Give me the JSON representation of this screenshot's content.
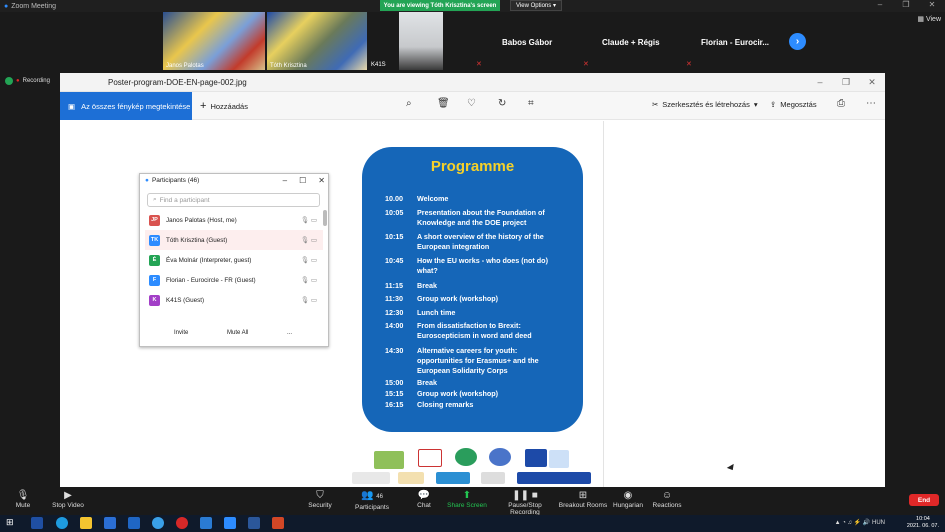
{
  "zoom": {
    "title": "Zoom Meeting",
    "viewing_banner": "You are viewing Tóth Krisztina's screen",
    "view_options": "View Options",
    "view_button": "View"
  },
  "thumbnails": [
    {
      "label": "Janos Palotas"
    },
    {
      "label": "Tóth Krisztina"
    },
    {
      "label": "K41S"
    }
  ],
  "participant_names": [
    "Babos Gábor",
    "Claude + Régis",
    "Florian - Eurocir..."
  ],
  "recording": {
    "label": "Recording"
  },
  "photos_app": {
    "filename": "Poster-program-DOE-EN-page-002.jpg",
    "all_photos": "Az összes fénykép megtekintése",
    "add": "Hozzáadás",
    "edit_create": "Szerkesztés és létrehozás",
    "share": "Megosztás"
  },
  "poster": {
    "title": "Programme",
    "rows": [
      {
        "time": "10.00",
        "event": "Welcome"
      },
      {
        "time": "10:05",
        "event": "Presentation about the Foundation of Knowledge and the DOE project"
      },
      {
        "time": "10:15",
        "event": "A short overview of the history of the European integration"
      },
      {
        "time": "10:45",
        "event": "How the EU works - who does (not do) what?"
      },
      {
        "time": "11:15",
        "event": "Break"
      },
      {
        "time": "11:30",
        "event": "Group work (workshop)"
      },
      {
        "time": "12:30",
        "event": "Lunch time"
      },
      {
        "time": "14:00",
        "event": "From dissatisfaction to Brexit: Euroscepticism in word and deed"
      },
      {
        "time": "14:30",
        "event": "Alternative careers for youth: opportunities for Erasmus+ and the European Solidarity Corps"
      },
      {
        "time": "15:00",
        "event": "Break"
      },
      {
        "time": "15:15",
        "event": "Group work (workshop)"
      },
      {
        "time": "16:15",
        "event": "Closing remarks"
      }
    ]
  },
  "participants_panel": {
    "title": "Participants (46)",
    "search_placeholder": "Find a participant",
    "people": [
      {
        "initials": "JP",
        "name": "Janos Palotas (Host, me)",
        "color": "#d9534f"
      },
      {
        "initials": "TK",
        "name": "Tóth Krisztina (Guest)",
        "color": "#2d8cff"
      },
      {
        "initials": "É",
        "name": "Éva Molnár (Interpreter, guest)",
        "color": "#23a455"
      },
      {
        "initials": "F",
        "name": "Florian - Eurocircle - FR (Guest)",
        "color": "#2d8cff"
      },
      {
        "initials": "K",
        "name": "K41S (Guest)",
        "color": "#a23fc7"
      }
    ],
    "invite": "Invite",
    "mute_all": "Mute All",
    "more": "..."
  },
  "bottom_bar": {
    "mute": "Mute",
    "stop_video": "Stop Video",
    "security": "Security",
    "participants": "Participants",
    "participants_count": "46",
    "chat": "Chat",
    "share_screen": "Share Screen",
    "pause_recording": "Pause/Stop Recording",
    "breakout": "Breakout Rooms",
    "hungarian": "Hungarian",
    "reactions": "Reactions",
    "end": "End"
  },
  "taskbar": {
    "lang": "HUN",
    "time": "10:04",
    "date": "2021. 06. 07."
  }
}
